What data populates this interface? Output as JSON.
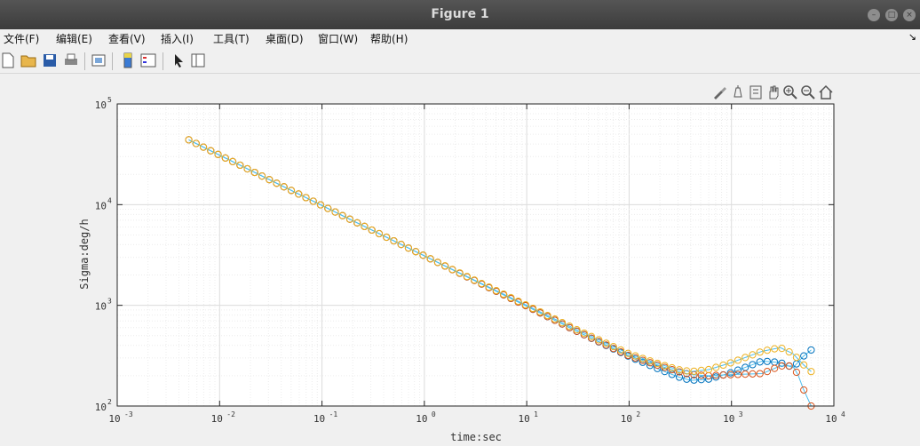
{
  "window": {
    "title": "Figure 1"
  },
  "menu": [
    "文件(F)",
    "编辑(E)",
    "查看(V)",
    "插入(I)",
    "工具(T)",
    "桌面(D)",
    "窗口(W)",
    "帮助(H)"
  ],
  "menu_overflow_icon": "arrow-icon",
  "toolbar_icons": [
    "new-figure-icon",
    "open-icon",
    "save-icon",
    "print-icon",
    "link-plot-icon",
    "colorbar-icon",
    "legend-icon",
    "pointer-icon",
    "property-editor-icon"
  ],
  "axes_toolbar_icons": [
    "brush-icon",
    "data-tips-icon",
    "plot-browser-icon",
    "pan-icon",
    "zoom-in-icon",
    "zoom-out-icon",
    "home-icon"
  ],
  "colors": {
    "series1": "#0072bd",
    "series2": "#d95319",
    "series3": "#edb120",
    "line": "#4dbeee"
  },
  "chart_data": {
    "type": "line",
    "xlabel": "time:sec",
    "ylabel": "Sigma:deg/h",
    "xscale": "log",
    "yscale": "log",
    "xlim": [
      0.001,
      10000
    ],
    "ylim": [
      100,
      100000
    ],
    "xticks": [
      "10",
      "10",
      "10",
      "10",
      "10",
      "10",
      "10",
      "10"
    ],
    "xtick_exps": [
      "-3",
      "-2",
      "-1",
      "0",
      "1",
      "2",
      "3",
      "4"
    ],
    "yticks": [
      "10",
      "10",
      "10",
      "10"
    ],
    "ytick_exps": [
      "2",
      "3",
      "4",
      "5"
    ],
    "grid": true,
    "minor_grid": true,
    "series": [
      {
        "x": [
          0.005,
          0.01,
          0.1,
          1,
          10,
          30,
          100,
          200,
          300,
          400,
          600,
          1000,
          2000,
          3000,
          4000,
          5000,
          6000
        ],
        "y": [
          44000,
          31000,
          9800,
          3100,
          980,
          560,
          310,
          230,
          195,
          180,
          185,
          215,
          280,
          270,
          240,
          310,
          360
        ]
      },
      {
        "x": [
          0.005,
          0.01,
          0.1,
          1,
          10,
          30,
          100,
          200,
          300,
          400,
          600,
          1000,
          2000,
          3000,
          4000,
          4500,
          5000,
          6000
        ],
        "y": [
          44000,
          31000,
          9800,
          3100,
          980,
          560,
          315,
          250,
          220,
          205,
          200,
          205,
          210,
          250,
          250,
          200,
          150,
          100
        ]
      },
      {
        "x": [
          0.005,
          0.01,
          0.1,
          1,
          10,
          30,
          100,
          200,
          300,
          400,
          600,
          1000,
          2000,
          3000,
          4000,
          5000,
          6000
        ],
        "y": [
          44000,
          31000,
          9800,
          3100,
          1000,
          580,
          330,
          260,
          230,
          220,
          230,
          270,
          350,
          380,
          330,
          260,
          220
        ]
      }
    ]
  }
}
